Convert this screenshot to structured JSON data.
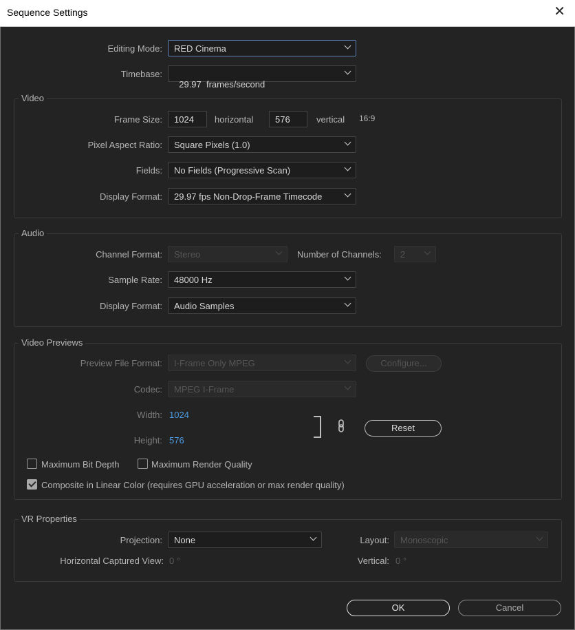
{
  "window": {
    "title": "Sequence Settings",
    "close_glyph": "✕"
  },
  "general": {
    "editing_mode_label": "Editing Mode:",
    "editing_mode_value": "RED Cinema",
    "timebase_label": "Timebase:",
    "timebase_value": "29.97  frames/second"
  },
  "video": {
    "title": "Video",
    "frame_size_label": "Frame Size:",
    "horizontal_value": "1024",
    "horizontal_label": "horizontal",
    "vertical_value": "576",
    "vertical_label": "vertical",
    "aspect": "16:9",
    "pixel_aspect_label": "Pixel Aspect Ratio:",
    "pixel_aspect_value": "Square Pixels (1.0)",
    "fields_label": "Fields:",
    "fields_value": "No Fields (Progressive Scan)",
    "display_format_label": "Display Format:",
    "display_format_value": "29.97 fps Non-Drop-Frame Timecode"
  },
  "audio": {
    "title": "Audio",
    "channel_format_label": "Channel Format:",
    "channel_format_value": "Stereo",
    "num_channels_label": "Number of Channels:",
    "num_channels_value": "2",
    "sample_rate_label": "Sample Rate:",
    "sample_rate_value": "48000 Hz",
    "display_format_label": "Display Format:",
    "display_format_value": "Audio Samples"
  },
  "previews": {
    "title": "Video Previews",
    "file_format_label": "Preview File Format:",
    "file_format_value": "I-Frame Only MPEG",
    "configure_label": "Configure...",
    "codec_label": "Codec:",
    "codec_value": "MPEG I-Frame",
    "width_label": "Width:",
    "width_value": "1024",
    "height_label": "Height:",
    "height_value": "576",
    "reset_label": "Reset",
    "link_icon": "chain-link-icon"
  },
  "options": {
    "max_bit_depth": {
      "label": "Maximum Bit Depth",
      "checked": false
    },
    "max_render_quality": {
      "label": "Maximum Render Quality",
      "checked": false
    },
    "composite_linear": {
      "label": "Composite in Linear Color (requires GPU acceleration or max render quality)",
      "checked": true
    }
  },
  "vr": {
    "title": "VR Properties",
    "projection_label": "Projection:",
    "projection_value": "None",
    "layout_label": "Layout:",
    "layout_value": "Monoscopic",
    "h_view_label": "Horizontal Captured View:",
    "h_view_value": "0 °",
    "vertical_label": "Vertical:",
    "vertical_value": "0 °"
  },
  "footer": {
    "ok_label": "OK",
    "cancel_label": "Cancel"
  },
  "colors": {
    "background": "#232323",
    "accent_blue": "#4e9ce3",
    "focus_border": "#5f83b8"
  }
}
